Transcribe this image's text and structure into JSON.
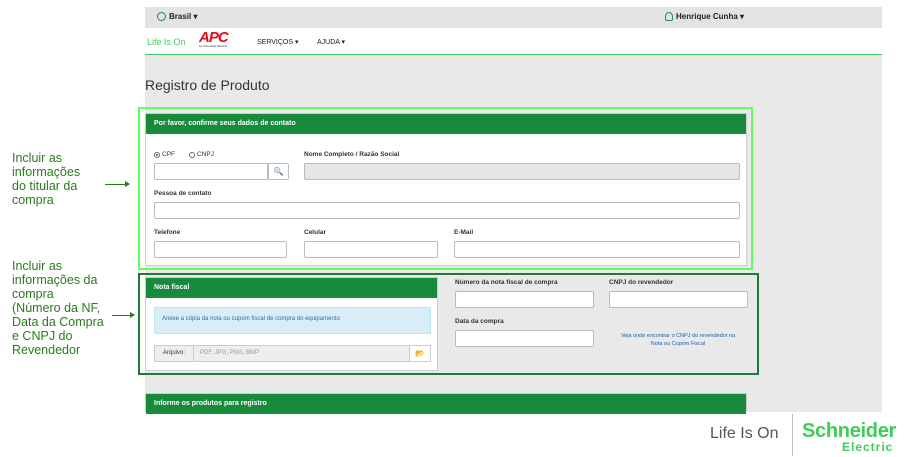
{
  "topbar": {
    "language": "Brasil ▾",
    "user": "Henrique Cunha ▾"
  },
  "navbar": {
    "life_is_on": "Life Is On",
    "brand": "APC",
    "brand_sub": "by Schneider Electric",
    "menu": [
      "SERVIÇOS ▾",
      "AJUDA ▾"
    ]
  },
  "page": {
    "title": "Registro de Produto"
  },
  "contact_panel": {
    "header": "Por favor, confirme seus dados de contato",
    "doc_types": [
      "CPF",
      "CNPJ"
    ],
    "selected_doc_type": "CPF",
    "labels": {
      "name": "Nome Completo / Razão Social",
      "contact": "Pessoa de contato",
      "phone": "Telefone",
      "mobile": "Celular",
      "email": "E-Mail"
    }
  },
  "invoice_panel": {
    "header": "Nota fiscal",
    "info": "Anexe a cópia da nota ou cupom fiscal de compra do equipamento",
    "file_label": "Arquivo:",
    "file_placeholder": "PDF, JPG, PNG, BMP",
    "labels": {
      "invoice_number": "Número da nota fiscal de compra",
      "reseller_cnpj": "CNPJ do revendedor",
      "purchase_date": "Data da compra"
    },
    "help_link": "Veja onde encontrar o CNPJ do revendedor na Nota ou Cupom Fiscal"
  },
  "products_panel": {
    "header": "Informe os produtos para registro"
  },
  "annotations": {
    "contact": [
      "Incluir as",
      "informações",
      "do titular da",
      "compra"
    ],
    "invoice": [
      "Incluir as",
      "informações da",
      "compra",
      "(Número da NF,",
      "Data da Compra",
      "e CNPJ do",
      "Revendedor"
    ]
  },
  "footer": {
    "life_is_on": "Life Is On",
    "brand": "Schneider",
    "brand_sub": "Electric"
  },
  "colors": {
    "brand_green": "#3dcd58",
    "panel_header": "#178a3c",
    "apc_red": "#e10f1f",
    "highlight_light": "#5fff5f",
    "highlight_dark": "#1f7a3a"
  },
  "icons": {
    "language": "globe-icon",
    "user": "user-icon",
    "search": "search-icon",
    "folder": "folder-icon"
  }
}
